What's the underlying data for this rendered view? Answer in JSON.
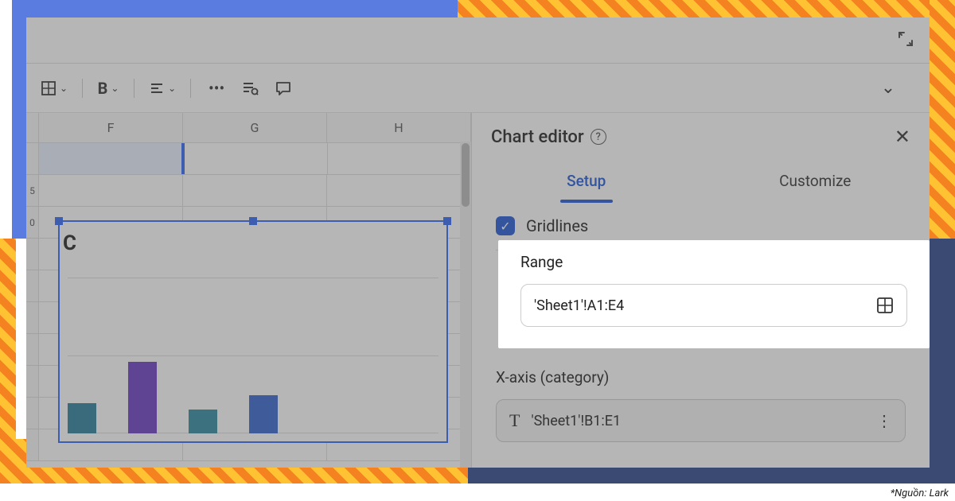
{
  "attribution": "*Nguồn: Lark",
  "toolbar": {
    "bold": "B"
  },
  "columns": [
    "F",
    "G",
    "H"
  ],
  "row_labels": [
    "",
    "5",
    "0"
  ],
  "chart_preview": {
    "title_fragment": "C"
  },
  "editor": {
    "title": "Chart editor",
    "tabs": {
      "setup": "Setup",
      "customize": "Customize"
    },
    "gridlines_label": "Gridlines",
    "range_label": "Range",
    "range_value": "'Sheet1'!A1:E4",
    "xaxis_label": "X-axis (category)",
    "xaxis_value": "'Sheet1'!B1:E1"
  }
}
